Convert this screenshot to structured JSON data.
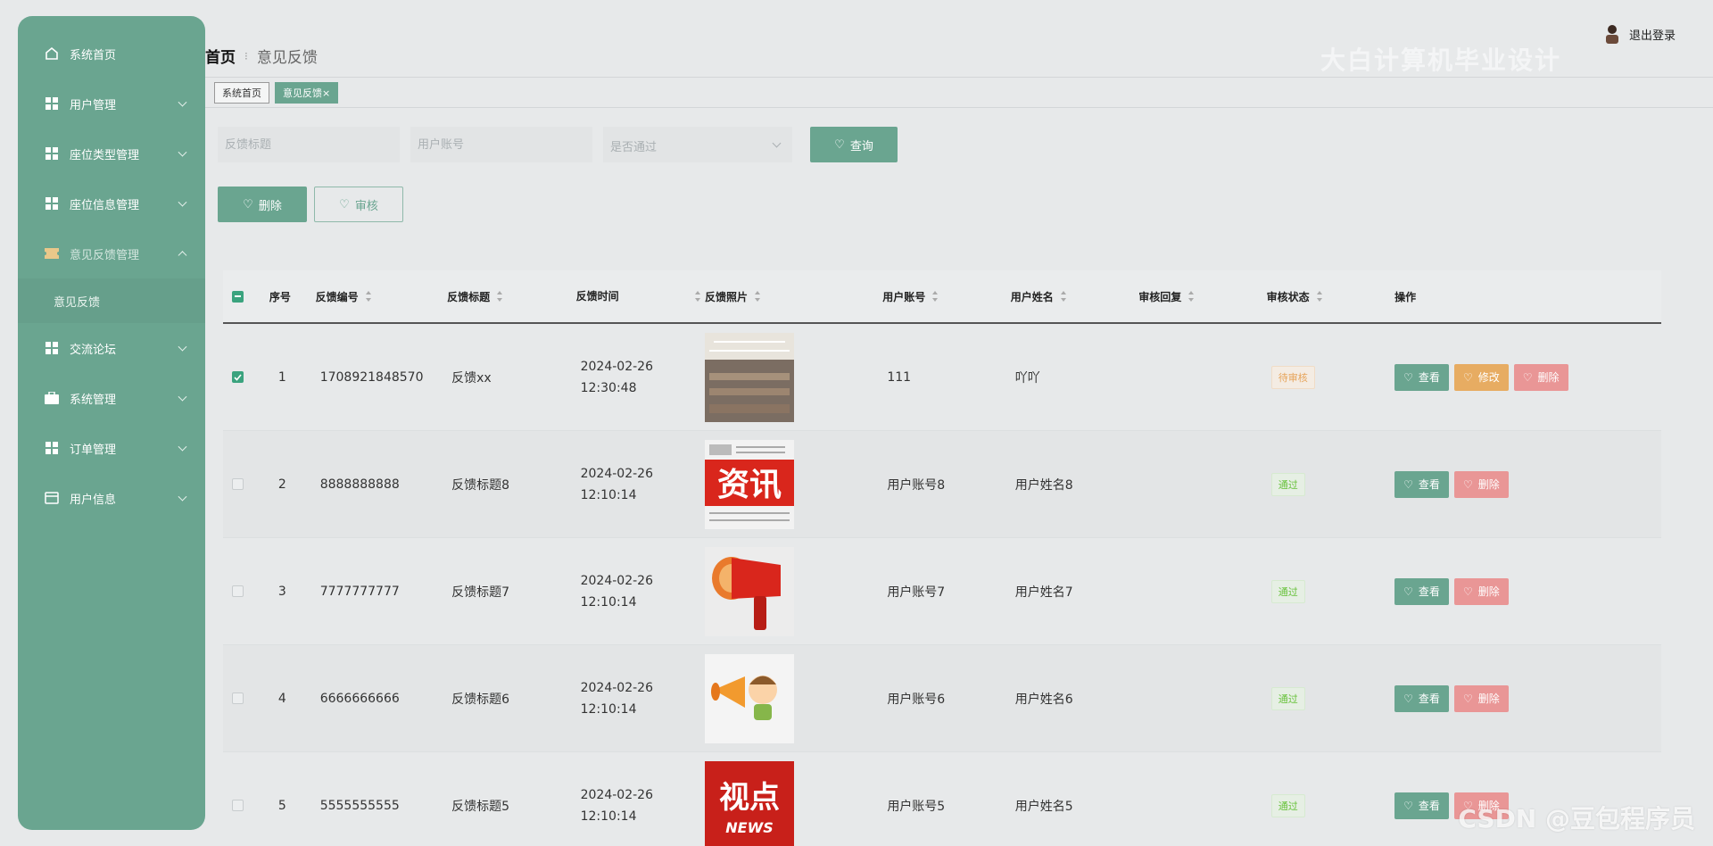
{
  "sidebar": {
    "items": [
      {
        "label": "系统首页",
        "icon": "home-icon",
        "has_chevron": false
      },
      {
        "label": "用户管理",
        "icon": "grid-icon",
        "has_chevron": true
      },
      {
        "label": "座位类型管理",
        "icon": "grid-icon",
        "has_chevron": true
      },
      {
        "label": "座位信息管理",
        "icon": "grid-icon",
        "has_chevron": true
      },
      {
        "label": "意见反馈管理",
        "icon": "ticket-icon",
        "has_chevron": true,
        "expanded": true
      },
      {
        "label": "交流论坛",
        "icon": "grid-icon",
        "has_chevron": true
      },
      {
        "label": "系统管理",
        "icon": "briefcase-icon",
        "has_chevron": true
      },
      {
        "label": "订单管理",
        "icon": "grid-icon",
        "has_chevron": true
      },
      {
        "label": "用户信息",
        "icon": "card-icon",
        "has_chevron": true
      }
    ],
    "sub_item": "意见反馈"
  },
  "header": {
    "breadcrumb_home": "首页",
    "breadcrumb_current": "意见反馈",
    "logout": "退出登录",
    "watermark": "大白计算机毕业设计"
  },
  "tabs": [
    {
      "label": "系统首页"
    },
    {
      "label": "意见反馈×"
    }
  ],
  "search": {
    "title_placeholder": "反馈标题",
    "account_placeholder": "用户账号",
    "passed_placeholder": "是否通过",
    "search_button": "查询"
  },
  "actions": {
    "delete": "删除",
    "audit": "审核"
  },
  "table": {
    "columns": [
      "序号",
      "反馈编号",
      "反馈标题",
      "反馈时间",
      "反馈照片",
      "用户账号",
      "用户姓名",
      "审核回复",
      "审核状态",
      "操作"
    ],
    "rows": [
      {
        "idx": "1",
        "no": "1708921848570",
        "title": "反馈xx",
        "time": "2024-02-26 12:30:48",
        "photo": "office-photo",
        "account": "111",
        "name": "吖吖",
        "reply": "",
        "status": "待审核",
        "status_type": "pending",
        "ops": [
          "查看",
          "修改",
          "删除"
        ],
        "checked": true
      },
      {
        "idx": "2",
        "no": "8888888888",
        "title": "反馈标题8",
        "time": "2024-02-26 12:10:14",
        "photo": "news-photo",
        "account": "用户账号8",
        "name": "用户姓名8",
        "reply": "",
        "status": "通过",
        "status_type": "pass",
        "ops": [
          "查看",
          "删除"
        ],
        "checked": false
      },
      {
        "idx": "3",
        "no": "7777777777",
        "title": "反馈标题7",
        "time": "2024-02-26 12:10:14",
        "photo": "megaphone-photo",
        "account": "用户账号7",
        "name": "用户姓名7",
        "reply": "",
        "status": "通过",
        "status_type": "pass",
        "ops": [
          "查看",
          "删除"
        ],
        "checked": false
      },
      {
        "idx": "4",
        "no": "6666666666",
        "title": "反馈标题6",
        "time": "2024-02-26 12:10:14",
        "photo": "cartoon-photo",
        "account": "用户账号6",
        "name": "用户姓名6",
        "reply": "",
        "status": "通过",
        "status_type": "pass",
        "ops": [
          "查看",
          "删除"
        ],
        "checked": false
      },
      {
        "idx": "5",
        "no": "5555555555",
        "title": "反馈标题5",
        "time": "2024-02-26 12:10:14",
        "photo": "viewpoint-photo",
        "account": "用户账号5",
        "name": "用户姓名5",
        "reply": "",
        "status": "通过",
        "status_type": "pass",
        "ops": [
          "查看",
          "删除"
        ],
        "checked": false
      }
    ]
  },
  "photo_text": {
    "news": "资讯",
    "viewpoint": "视点",
    "viewpoint_sub": "NEWS"
  },
  "footer_watermark": "CSDN @豆包程序员",
  "colors": {
    "accent": "#6aa590",
    "edit": "#e7ac62",
    "danger": "#e99696",
    "pending": "#e6a45a",
    "pass": "#67c23a"
  }
}
